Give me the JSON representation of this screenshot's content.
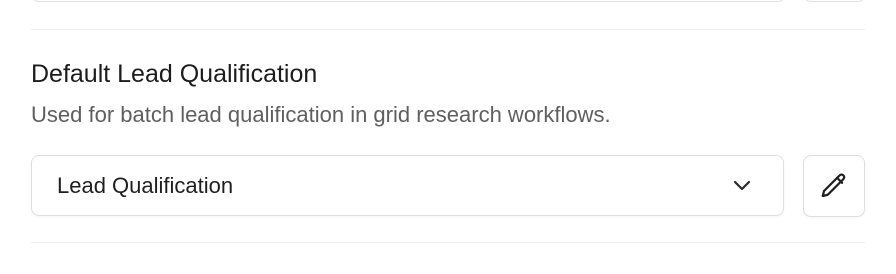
{
  "section": {
    "title": "Default Lead Qualification",
    "description": "Used for batch lead qualification in grid research workflows."
  },
  "select": {
    "value": "Lead Qualification",
    "icon": "chevron-down-icon"
  },
  "edit_button": {
    "icon": "pencil-icon"
  },
  "colors": {
    "border": "#dedede",
    "text": "#1f1f1f",
    "muted_text": "#5f5f5f",
    "divider": "#ececec"
  }
}
